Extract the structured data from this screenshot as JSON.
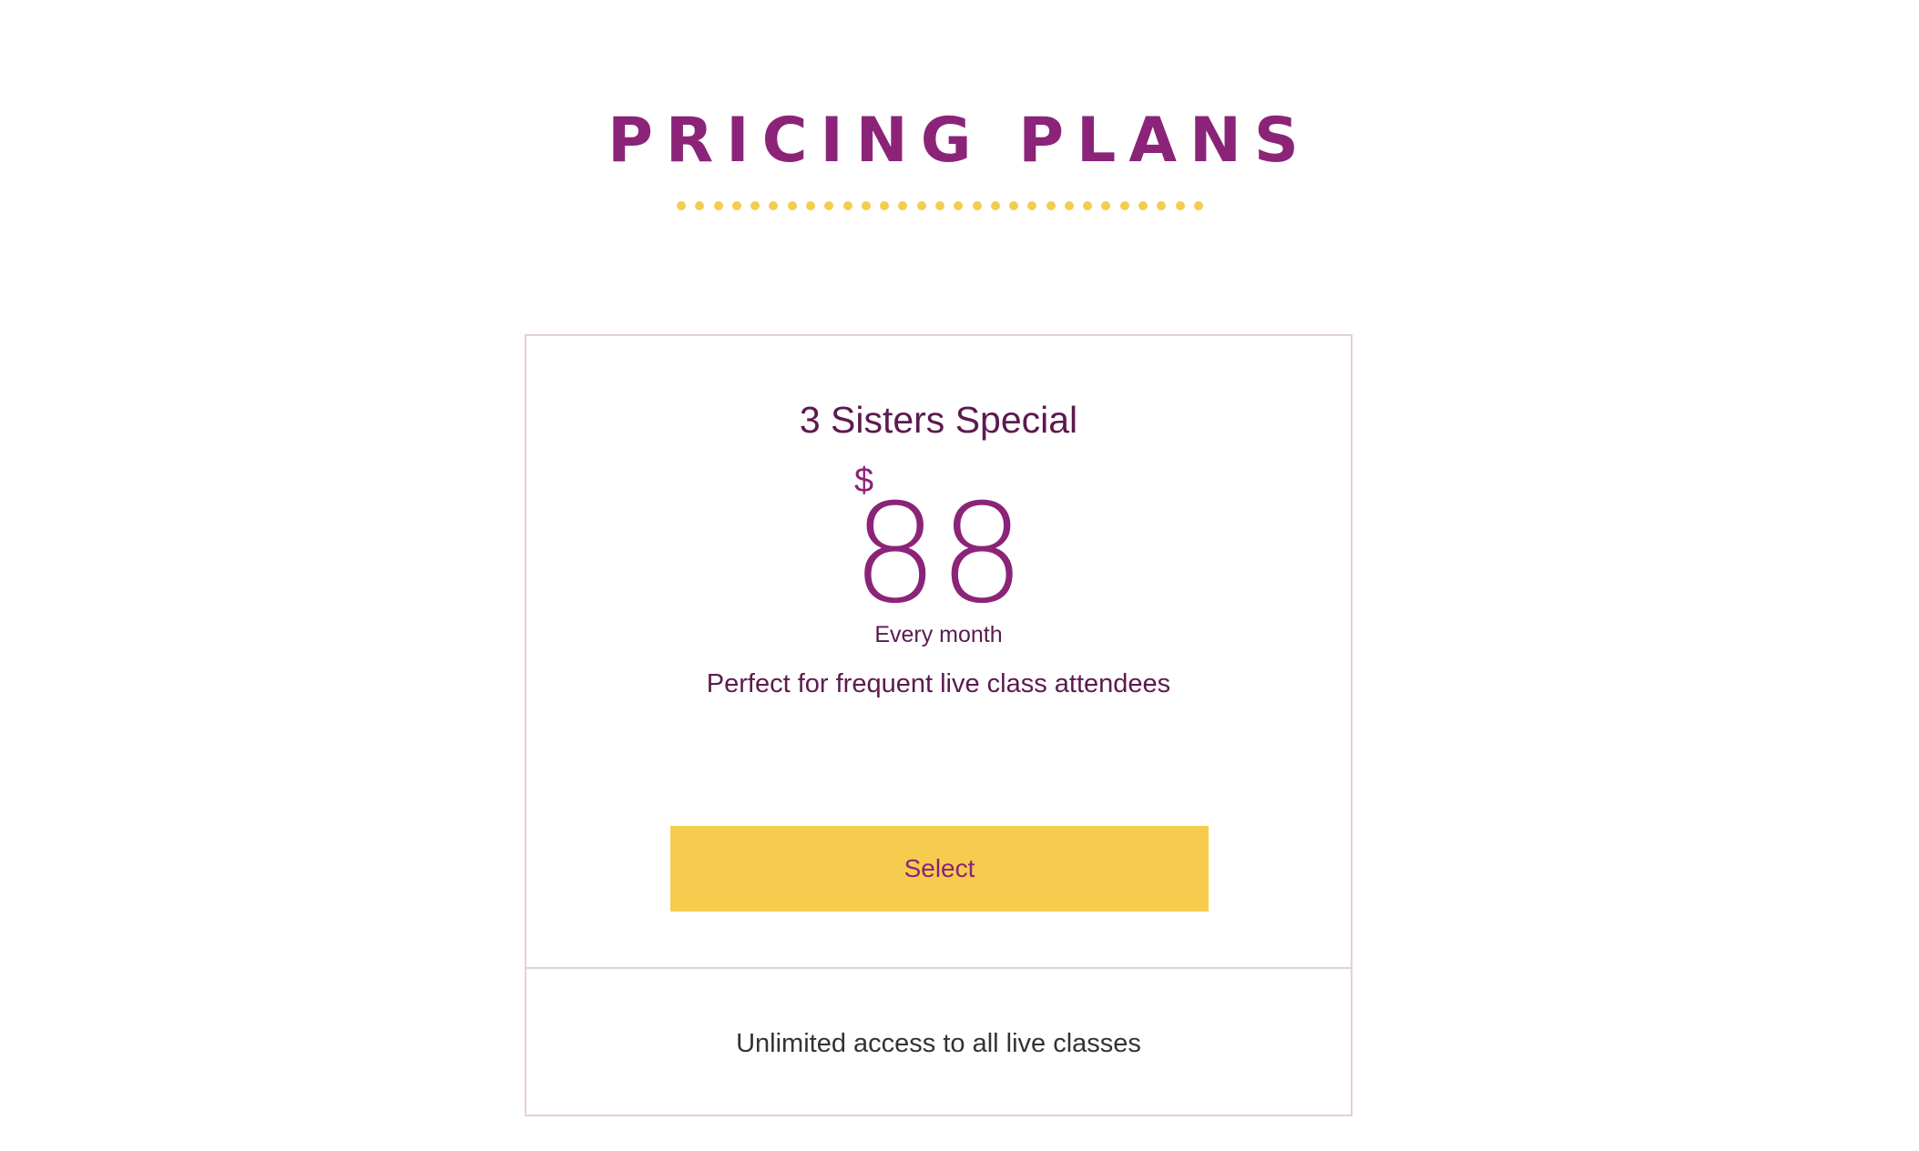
{
  "header": {
    "title": "PRICING PLANS",
    "divider_dot_count": 29
  },
  "plan": {
    "name": "3 Sisters Special",
    "currency_symbol": "$",
    "price": "88",
    "period": "Every month",
    "description": "Perfect for frequent live class attendees",
    "select_label": "Select",
    "features": [
      "Unlimited access to all live classes"
    ]
  },
  "colors": {
    "accent_purple": "#8b2478",
    "text_plum": "#5c1a4f",
    "button_yellow": "#f5cc4d",
    "card_border": "#e5cfd9"
  }
}
